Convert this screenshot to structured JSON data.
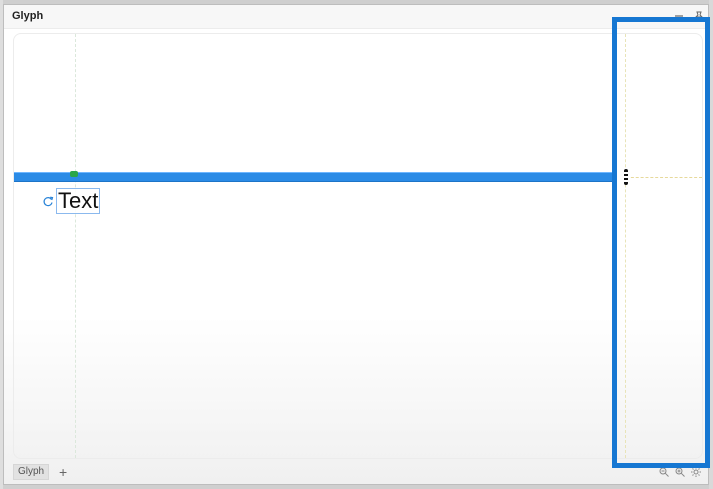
{
  "window": {
    "title": "Glyph"
  },
  "canvas": {
    "glyph_text": "Text"
  },
  "bottom_bar": {
    "tab_label": "Glyph",
    "add_symbol": "+"
  },
  "icons": {
    "minimize": "minimize-icon",
    "pin": "pin-icon",
    "rotate": "rotate-icon",
    "resize": "resize-handle-icon",
    "zoom_out": "zoom-out-icon",
    "zoom_in": "zoom-in-icon",
    "settings": "settings-icon"
  },
  "colors": {
    "selection_blue": "#2b8be6",
    "focus_outline": "#1677d2",
    "guide_green": "#2aa64a"
  }
}
